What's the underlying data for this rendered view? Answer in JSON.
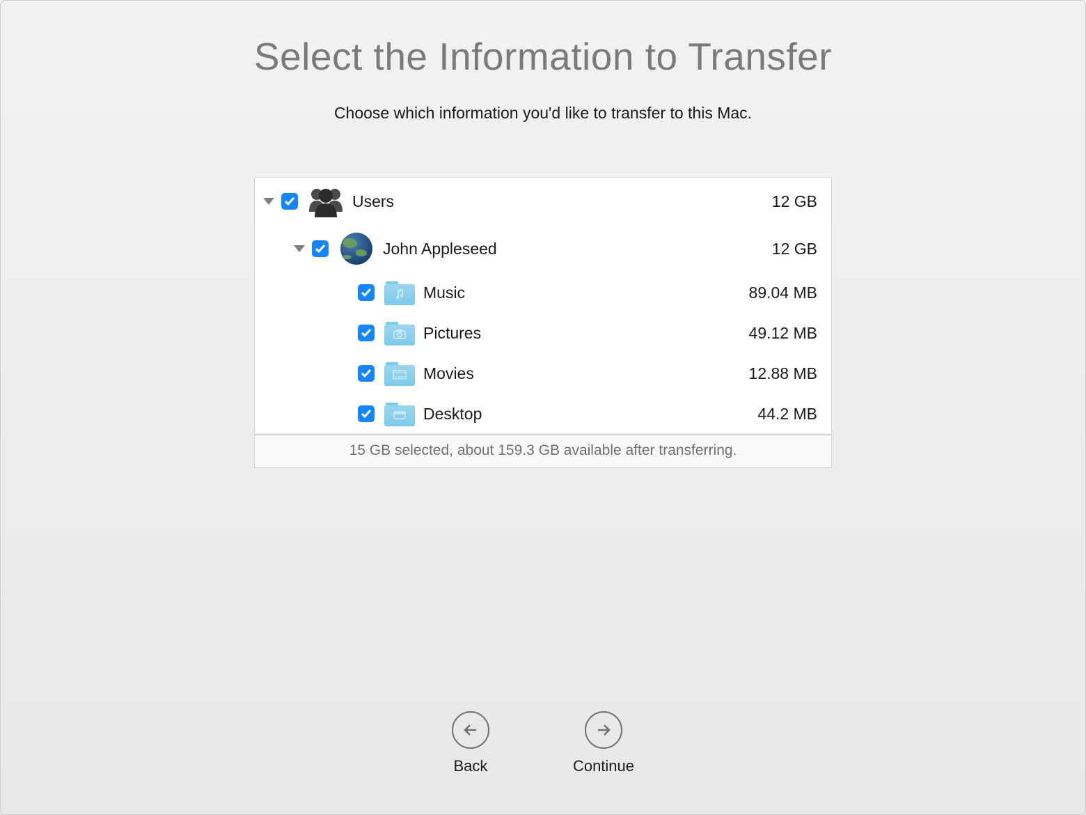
{
  "title": "Select the Information to Transfer",
  "subtitle": "Choose which information you'd like to transfer to this Mac.",
  "tree": {
    "users_label": "Users",
    "users_size": "12 GB",
    "user_name": "John Appleseed",
    "user_size": "12 GB",
    "items": [
      {
        "label": "Music",
        "size": "89.04 MB"
      },
      {
        "label": "Pictures",
        "size": "49.12 MB"
      },
      {
        "label": "Movies",
        "size": "12.88 MB"
      },
      {
        "label": "Desktop",
        "size": "44.2 MB"
      }
    ]
  },
  "status": "15 GB selected, about 159.3 GB available after transferring.",
  "nav": {
    "back": "Back",
    "continue": "Continue"
  }
}
